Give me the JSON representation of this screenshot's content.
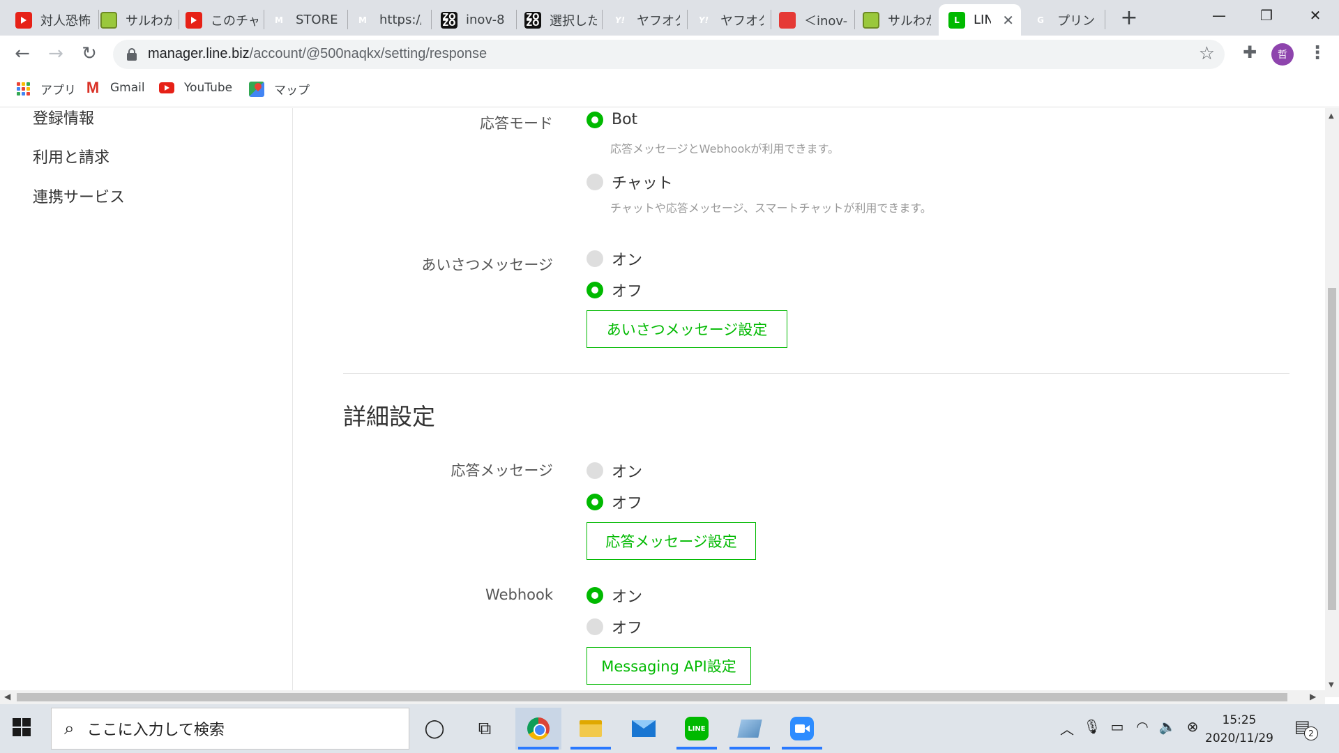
{
  "browser": {
    "tabs": [
      {
        "label": "対人恐怖",
        "icon": "youtube-icon"
      },
      {
        "label": "サルわか",
        "icon": "saru-icon"
      },
      {
        "label": "このチャン",
        "icon": "youtube-icon"
      },
      {
        "label": "STORE",
        "icon": "m-logo-icon"
      },
      {
        "label": "https://",
        "icon": "m-logo-icon"
      },
      {
        "label": "inov-8",
        "icon": "zozo-icon"
      },
      {
        "label": "選択した",
        "icon": "zozo-icon"
      },
      {
        "label": "ヤフオク!",
        "icon": "yahoo-icon"
      },
      {
        "label": "ヤフオク!",
        "icon": "yahoo-icon"
      },
      {
        "label": "＜inov-",
        "icon": "red-tag-icon"
      },
      {
        "label": "サルわか",
        "icon": "saru-icon"
      },
      {
        "label": "LINE",
        "icon": "line-icon",
        "active": true
      },
      {
        "label": "プリント",
        "icon": "google-icon"
      }
    ],
    "url_host": "manager.line.biz",
    "url_path": "/account/@500naqkx/setting/response",
    "profile_initial": "哲",
    "bookmarks": [
      {
        "label": "アプリ",
        "icon": "apps-grid-icon"
      },
      {
        "label": "Gmail",
        "icon": "gmail-icon"
      },
      {
        "label": "YouTube",
        "icon": "youtube-icon"
      },
      {
        "label": "マップ",
        "icon": "maps-icon"
      }
    ]
  },
  "sidebar": {
    "items": [
      "登録情報",
      "利用と請求",
      "連携サービス"
    ]
  },
  "settings": {
    "response_mode": {
      "label": "応答モード",
      "options": [
        {
          "label": "Bot",
          "help": "応答メッセージとWebhookが利用できます。",
          "selected": true
        },
        {
          "label": "チャット",
          "help": "チャットや応答メッセージ、スマートチャットが利用できます。",
          "selected": false
        }
      ]
    },
    "greeting": {
      "label": "あいさつメッセージ",
      "on_label": "オン",
      "off_label": "オフ",
      "value": "off",
      "button": "あいさつメッセージ設定"
    },
    "advanced_title": "詳細設定",
    "auto_response": {
      "label": "応答メッセージ",
      "on_label": "オン",
      "off_label": "オフ",
      "value": "off",
      "button": "応答メッセージ設定"
    },
    "webhook": {
      "label": "Webhook",
      "on_label": "オン",
      "off_label": "オフ",
      "value": "on",
      "button": "Messaging API設定"
    }
  },
  "taskbar": {
    "search_placeholder": "ここに入力して検索",
    "time": "15:25",
    "date": "2020/11/29",
    "notification_count": "2"
  },
  "colors": {
    "line_green": "#00b900",
    "tabstrip": "#dee1e6"
  }
}
